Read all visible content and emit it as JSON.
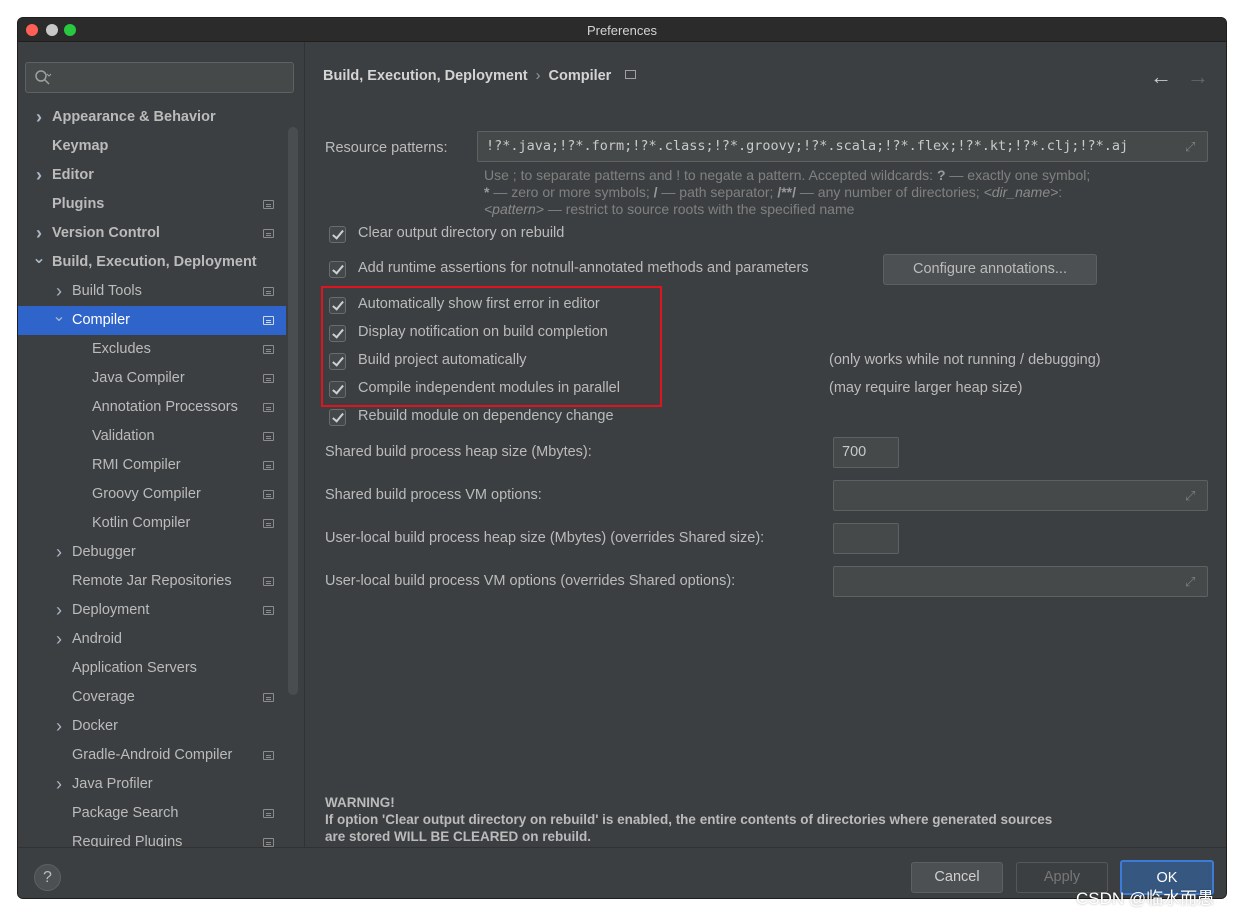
{
  "window": {
    "title": "Preferences"
  },
  "search": {
    "placeholder": ""
  },
  "sidebar": {
    "items": [
      {
        "label": "Appearance & Behavior",
        "level": 0,
        "bold": true,
        "chevron": "right",
        "page_icon": false
      },
      {
        "label": "Keymap",
        "level": 0,
        "bold": true,
        "chevron": "",
        "page_icon": false
      },
      {
        "label": "Editor",
        "level": 0,
        "bold": true,
        "chevron": "right",
        "page_icon": false
      },
      {
        "label": "Plugins",
        "level": 0,
        "bold": true,
        "chevron": "",
        "page_icon": true
      },
      {
        "label": "Version Control",
        "level": 0,
        "bold": true,
        "chevron": "right",
        "page_icon": true
      },
      {
        "label": "Build, Execution, Deployment",
        "level": 0,
        "bold": true,
        "chevron": "down",
        "page_icon": false
      },
      {
        "label": "Build Tools",
        "level": 1,
        "bold": false,
        "chevron": "right",
        "page_icon": true
      },
      {
        "label": "Compiler",
        "level": 1,
        "bold": false,
        "chevron": "down",
        "page_icon": true,
        "selected": true
      },
      {
        "label": "Excludes",
        "level": 2,
        "bold": false,
        "chevron": "",
        "page_icon": true
      },
      {
        "label": "Java Compiler",
        "level": 2,
        "bold": false,
        "chevron": "",
        "page_icon": true
      },
      {
        "label": "Annotation Processors",
        "level": 2,
        "bold": false,
        "chevron": "",
        "page_icon": true
      },
      {
        "label": "Validation",
        "level": 2,
        "bold": false,
        "chevron": "",
        "page_icon": true
      },
      {
        "label": "RMI Compiler",
        "level": 2,
        "bold": false,
        "chevron": "",
        "page_icon": true
      },
      {
        "label": "Groovy Compiler",
        "level": 2,
        "bold": false,
        "chevron": "",
        "page_icon": true
      },
      {
        "label": "Kotlin Compiler",
        "level": 2,
        "bold": false,
        "chevron": "",
        "page_icon": true
      },
      {
        "label": "Debugger",
        "level": 1,
        "bold": false,
        "chevron": "right",
        "page_icon": false
      },
      {
        "label": "Remote Jar Repositories",
        "level": 1,
        "bold": false,
        "chevron": "",
        "page_icon": true
      },
      {
        "label": "Deployment",
        "level": 1,
        "bold": false,
        "chevron": "right",
        "page_icon": true
      },
      {
        "label": "Android",
        "level": 1,
        "bold": false,
        "chevron": "right",
        "page_icon": false
      },
      {
        "label": "Application Servers",
        "level": 1,
        "bold": false,
        "chevron": "",
        "page_icon": false
      },
      {
        "label": "Coverage",
        "level": 1,
        "bold": false,
        "chevron": "",
        "page_icon": true
      },
      {
        "label": "Docker",
        "level": 1,
        "bold": false,
        "chevron": "right",
        "page_icon": false
      },
      {
        "label": "Gradle-Android Compiler",
        "level": 1,
        "bold": false,
        "chevron": "",
        "page_icon": true
      },
      {
        "label": "Java Profiler",
        "level": 1,
        "bold": false,
        "chevron": "right",
        "page_icon": false
      },
      {
        "label": "Package Search",
        "level": 1,
        "bold": false,
        "chevron": "",
        "page_icon": true
      },
      {
        "label": "Required Plugins",
        "level": 1,
        "bold": false,
        "chevron": "",
        "page_icon": true
      }
    ]
  },
  "breadcrumb": {
    "parent": "Build, Execution, Deployment",
    "separator": "›",
    "current": "Compiler"
  },
  "nav": {
    "back": "←",
    "forward": "→"
  },
  "resource": {
    "label": "Resource patterns:",
    "value": "!?*.java;!?*.form;!?*.class;!?*.groovy;!?*.scala;!?*.flex;!?*.kt;!?*.clj;!?*.aj",
    "hint_line1_a": "Use ; to separate patterns and ! to negate a pattern. Accepted wildcards: ",
    "hint_line1_b": "?",
    "hint_line1_c": " — exactly one symbol;",
    "hint_line2_a": "*",
    "hint_line2_b": " — zero or more symbols; ",
    "hint_line2_c": "/",
    "hint_line2_d": " — path separator; ",
    "hint_line2_e": "/**/",
    "hint_line2_f": " — any number of directories; ",
    "hint_line2_g": "<dir_name>",
    "hint_line2_h": ":",
    "hint_line3_a": "<pattern>",
    "hint_line3_b": " — restrict to source roots with the specified name"
  },
  "options": {
    "clear_output": "Clear output directory on rebuild",
    "runtime_assertions": "Add runtime assertions for notnull-annotated methods and parameters",
    "configure_annotations": "Configure annotations...",
    "show_first_error": "Automatically show first error in editor",
    "notify_completion": "Display notification on build completion",
    "build_automatically": "Build project automatically",
    "build_automatically_note": "(only works while not running / debugging)",
    "parallel": "Compile independent modules in parallel",
    "parallel_note": "(may require larger heap size)",
    "rebuild_module": "Rebuild module on dependency change"
  },
  "heap": {
    "shared_heap_label": "Shared build process heap size (Mbytes):",
    "shared_heap_value": "700",
    "shared_vm_label": "Shared build process VM options:",
    "shared_vm_value": "",
    "user_heap_label": "User-local build process heap size (Mbytes) (overrides Shared size):",
    "user_heap_value": "",
    "user_vm_label": "User-local build process VM options (overrides Shared options):",
    "user_vm_value": ""
  },
  "warning": {
    "title": "WARNING!",
    "line1": "If option 'Clear output directory on rebuild' is enabled, the entire contents of directories where generated sources",
    "line2": "are stored WILL BE CLEARED on rebuild."
  },
  "buttons": {
    "help": "?",
    "cancel": "Cancel",
    "apply": "Apply",
    "ok": "OK"
  },
  "watermark": "CSDN @临水而愚",
  "colors": {
    "background": "#3c3f41",
    "selection": "#2f65ca",
    "highlight": "#e0141e",
    "ok_border": "#3e7bd6"
  }
}
